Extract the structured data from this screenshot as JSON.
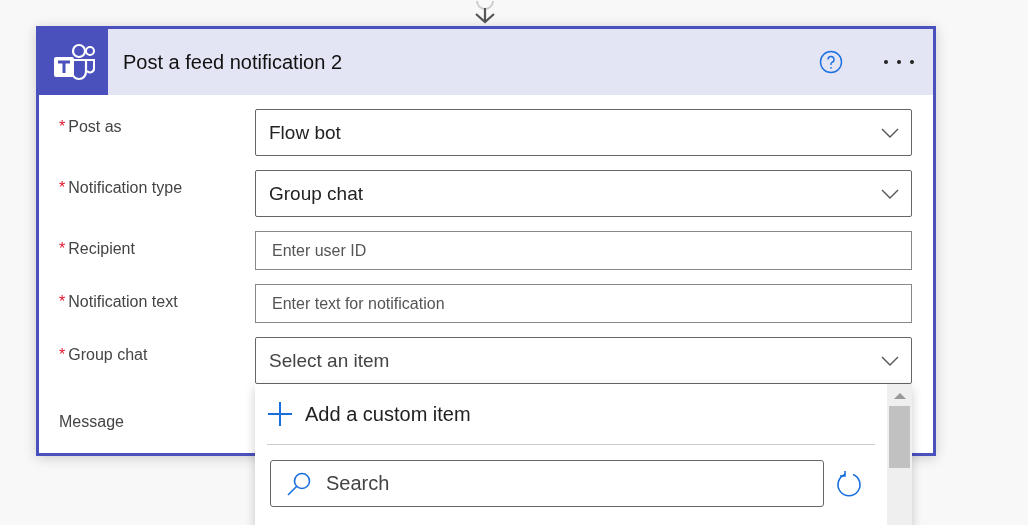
{
  "card": {
    "title": "Post a feed notification 2"
  },
  "fields": [
    {
      "label": "Post as",
      "required_mark": "*",
      "kind": "dropdown",
      "value": "Flow bot"
    },
    {
      "label": "Notification type",
      "required_mark": "*",
      "kind": "dropdown",
      "value": "Group chat"
    },
    {
      "label": "Recipient",
      "required_mark": "*",
      "kind": "text",
      "placeholder": "Enter user ID"
    },
    {
      "label": "Notification text",
      "required_mark": "*",
      "kind": "text",
      "placeholder": "Enter text for notification"
    },
    {
      "label": "Group chat",
      "required_mark": "*",
      "kind": "dropdown",
      "placeholder": "Select an item",
      "expanded": true
    },
    {
      "label": "Message",
      "kind": "hidden"
    }
  ],
  "dropdown_menu": {
    "add_item": "Add a custom item",
    "search": {
      "placeholder": "Search"
    }
  }
}
